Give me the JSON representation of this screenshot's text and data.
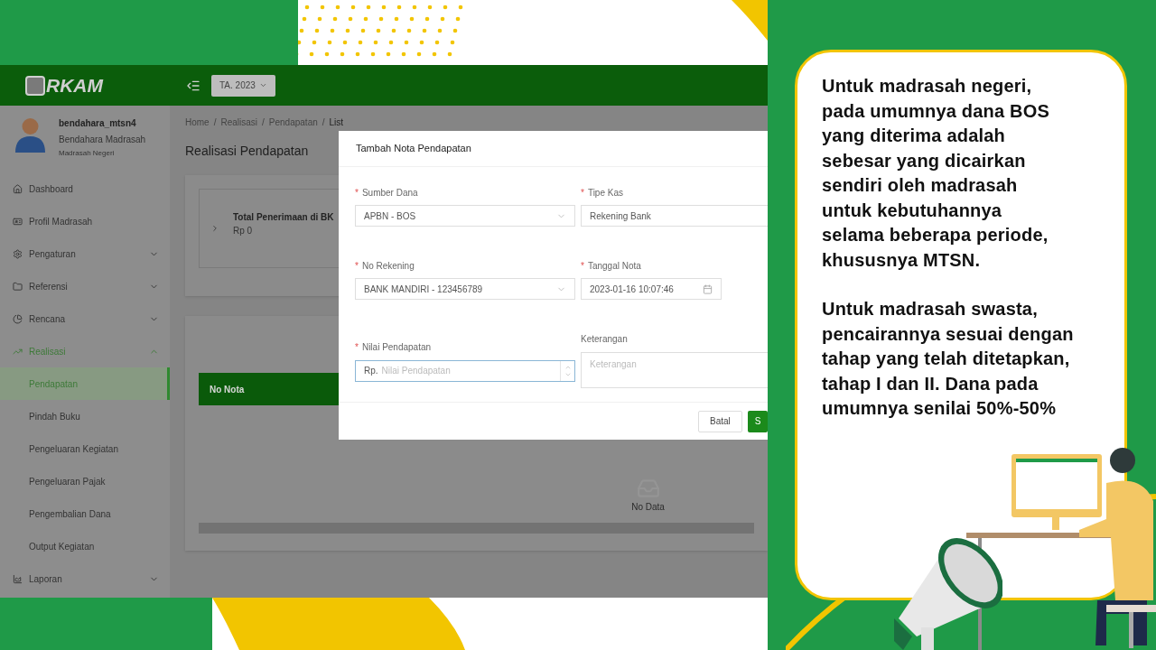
{
  "app": {
    "logo": "RKAM",
    "year_select": "TA. 2023",
    "user": {
      "name": "bendahara_mtsn4",
      "role": "Bendahara Madrasah",
      "unit": "Madrasah Negeri"
    },
    "sidebar": {
      "items": [
        {
          "label": "Dashboard",
          "selected": false
        },
        {
          "label": "Profil Madrasah",
          "selected": false
        },
        {
          "label": "Pengaturan",
          "expanded": false,
          "selected": false
        },
        {
          "label": "Referensi",
          "expanded": false,
          "selected": false
        },
        {
          "label": "Rencana",
          "expanded": false,
          "selected": false
        },
        {
          "label": "Realisasi",
          "expanded": true,
          "selected": true,
          "children": [
            {
              "label": "Pendapatan",
              "selected": true
            },
            {
              "label": "Pindah Buku",
              "selected": false
            },
            {
              "label": "Pengeluaran Kegiatan",
              "selected": false
            },
            {
              "label": "Pengeluaran Pajak",
              "selected": false
            },
            {
              "label": "Pengembalian Dana",
              "selected": false
            },
            {
              "label": "Output Kegiatan",
              "selected": false
            }
          ]
        },
        {
          "label": "Laporan",
          "expanded": false,
          "selected": false
        }
      ]
    },
    "breadcrumb": [
      "Home",
      "Realisasi",
      "Pendapatan",
      "List"
    ],
    "breadcrumb_separator": "/",
    "page_title": "Realisasi Pendapatan",
    "summary": {
      "label": "Total Penerimaan di BK",
      "value": "Rp 0"
    },
    "table": {
      "columns": [
        "No Nota"
      ],
      "empty_text": "No Data"
    },
    "modal": {
      "title": "Tambah Nota Pendapatan",
      "required_mark": "*",
      "fields": [
        {
          "label": "Sumber Dana",
          "required": true,
          "kind": "select",
          "value": "APBN - BOS"
        },
        {
          "label": "Tipe Kas",
          "required": true,
          "kind": "text",
          "value": "Rekening Bank"
        },
        {
          "label": "No Rekening",
          "required": true,
          "kind": "select",
          "value": "BANK MANDIRI - 123456789"
        },
        {
          "label": "Tanggal Nota",
          "required": true,
          "kind": "date",
          "value": "2023-01-16 10:07:46"
        },
        {
          "label": "Nilai Pendapatan",
          "required": true,
          "kind": "number",
          "prefix": "Rp.",
          "placeholder": "Nilai Pendapatan",
          "focused": true
        },
        {
          "label": "Keterangan",
          "required": false,
          "kind": "textarea",
          "placeholder": "Keterangan"
        }
      ],
      "buttons": [
        {
          "label": "Batal",
          "primary": false
        },
        {
          "label": "S",
          "primary": true
        }
      ]
    }
  },
  "info_card": {
    "paragraphs": [
      "Untuk madrasah negeri,\npada umumnya dana BOS\nyang diterima adalah\nsebesar yang dicairkan\nsendiri oleh madrasah\nuntuk kebutuhannya\nselama beberapa periode,\nkhususnya MTSN.",
      "Untuk madrasah swasta,\npencairannya sesuai dengan\ntahap yang telah ditetapkan,\ntahap I dan II. Dana pada\numumnya senilai 50%-50%"
    ]
  }
}
